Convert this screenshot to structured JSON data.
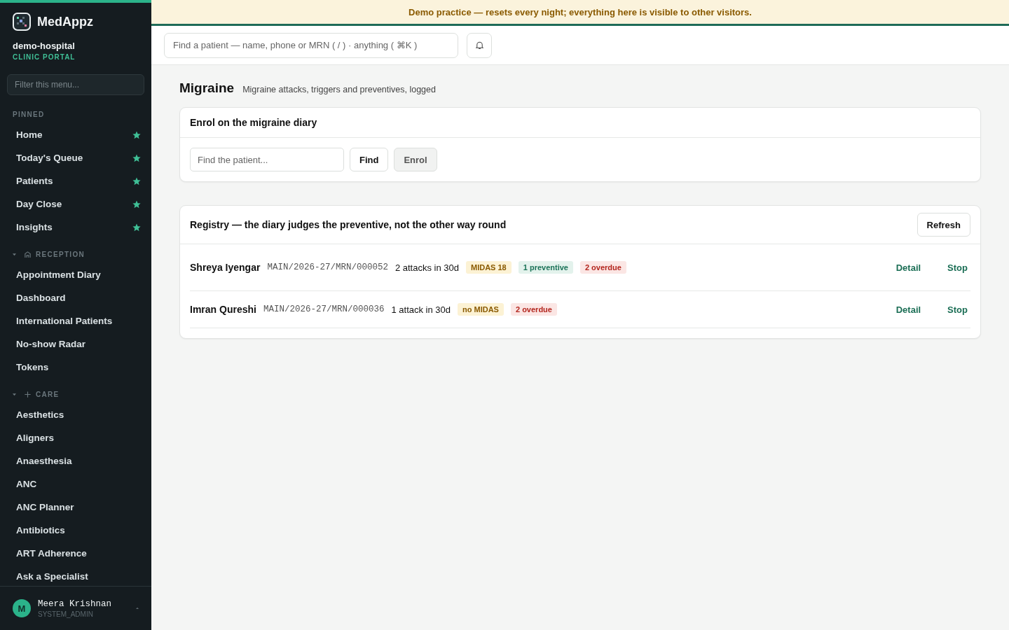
{
  "banner": "Demo practice — resets every night; everything here is visible to other visitors.",
  "brand": {
    "name": "MedAppz",
    "org": "demo-hospital",
    "portal": "CLINIC PORTAL"
  },
  "sidebar": {
    "filter_placeholder": "Filter this menu...",
    "groups": [
      {
        "label": "PINNED",
        "kind": "pinned",
        "items": [
          {
            "label": "Home",
            "starred": true
          },
          {
            "label": "Today's Queue",
            "starred": true
          },
          {
            "label": "Patients",
            "starred": true
          },
          {
            "label": "Day Close",
            "starred": true
          },
          {
            "label": "Insights",
            "starred": true
          }
        ]
      },
      {
        "label": "RECEPTION",
        "kind": "reception",
        "expanded": true,
        "items": [
          {
            "label": "Appointment Diary",
            "starred": false
          },
          {
            "label": "Dashboard",
            "starred": false
          },
          {
            "label": "International Patients",
            "starred": false
          },
          {
            "label": "No-show Radar",
            "starred": false
          },
          {
            "label": "Tokens",
            "starred": false
          }
        ]
      },
      {
        "label": "CARE",
        "kind": "care",
        "expanded": true,
        "items": [
          {
            "label": "Aesthetics",
            "starred": false
          },
          {
            "label": "Aligners",
            "starred": false
          },
          {
            "label": "Anaesthesia",
            "starred": false
          },
          {
            "label": "ANC",
            "starred": false
          },
          {
            "label": "ANC Planner",
            "starred": false
          },
          {
            "label": "Antibiotics",
            "starred": false
          },
          {
            "label": "ART Adherence",
            "starred": false
          },
          {
            "label": "Ask a Specialist",
            "starred": false
          }
        ]
      }
    ],
    "user": {
      "initial": "M",
      "name": "Meera Krishnan",
      "role": "SYSTEM_ADMIN"
    }
  },
  "search": {
    "placeholder": "Find a patient — name, phone or MRN ( / ) · anything ( ⌘K )"
  },
  "page": {
    "title": "Migraine",
    "subtitle": "Migraine attacks, triggers and preventives, logged"
  },
  "enrol": {
    "title": "Enrol on the migraine diary",
    "placeholder": "Find the patient...",
    "find": "Find",
    "enrol": "Enrol",
    "enrol_disabled": true
  },
  "registry": {
    "title": "Registry — the diary judges the preventive, not the other way round",
    "refresh": "Refresh",
    "rows": [
      {
        "name": "Shreya Iyengar",
        "mrn": "MAIN/2026-27/MRN/000052",
        "attacks": "2 attacks in 30d",
        "tags": [
          {
            "text": "MIDAS 18",
            "kind": "midas"
          },
          {
            "text": "1 preventive",
            "kind": "preventive"
          },
          {
            "text": "2 overdue",
            "kind": "overdue"
          }
        ],
        "actions": [
          "Detail",
          "Stop"
        ]
      },
      {
        "name": "Imran Qureshi",
        "mrn": "MAIN/2026-27/MRN/000036",
        "attacks": "1 attack in 30d",
        "tags": [
          {
            "text": "no MIDAS",
            "kind": "midas"
          },
          {
            "text": "2 overdue",
            "kind": "overdue"
          }
        ],
        "actions": [
          "Detail",
          "Stop"
        ]
      }
    ]
  }
}
